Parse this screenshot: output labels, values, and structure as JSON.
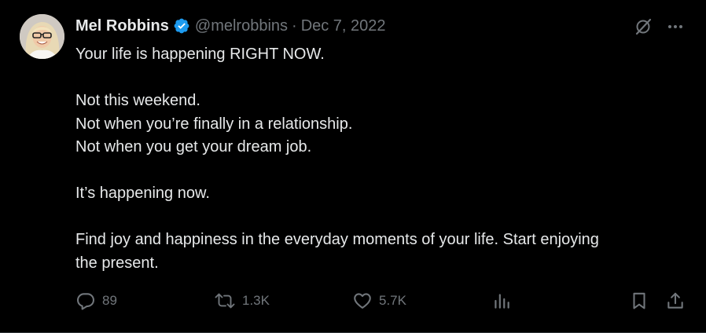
{
  "author": {
    "name": "Mel Robbins",
    "handle": "@melrobbins",
    "separator": "·",
    "date": "Dec 7, 2022",
    "verified": true
  },
  "tweet": {
    "paragraphs": [
      [
        "Your life is happening RIGHT NOW."
      ],
      [
        "Not this weekend.",
        "Not when you’re finally in a relationship.",
        "Not when you get your dream job."
      ],
      [
        "It’s happening now."
      ],
      [
        "Find joy and happiness in the everyday moments of your life. Start enjoying",
        "the present."
      ]
    ]
  },
  "stats": {
    "replies": "89",
    "retweets": "1.3K",
    "likes": "5.7K"
  },
  "icons": {
    "grok": "grok-icon",
    "more": "more-icon",
    "reply": "reply-icon",
    "retweet": "retweet-icon",
    "like": "like-icon",
    "views": "views-icon",
    "bookmark": "bookmark-icon",
    "share": "share-icon"
  },
  "colors": {
    "background": "#000000",
    "text": "#e7e9ea",
    "muted": "#71767b",
    "verified": "#1d9bf0"
  }
}
